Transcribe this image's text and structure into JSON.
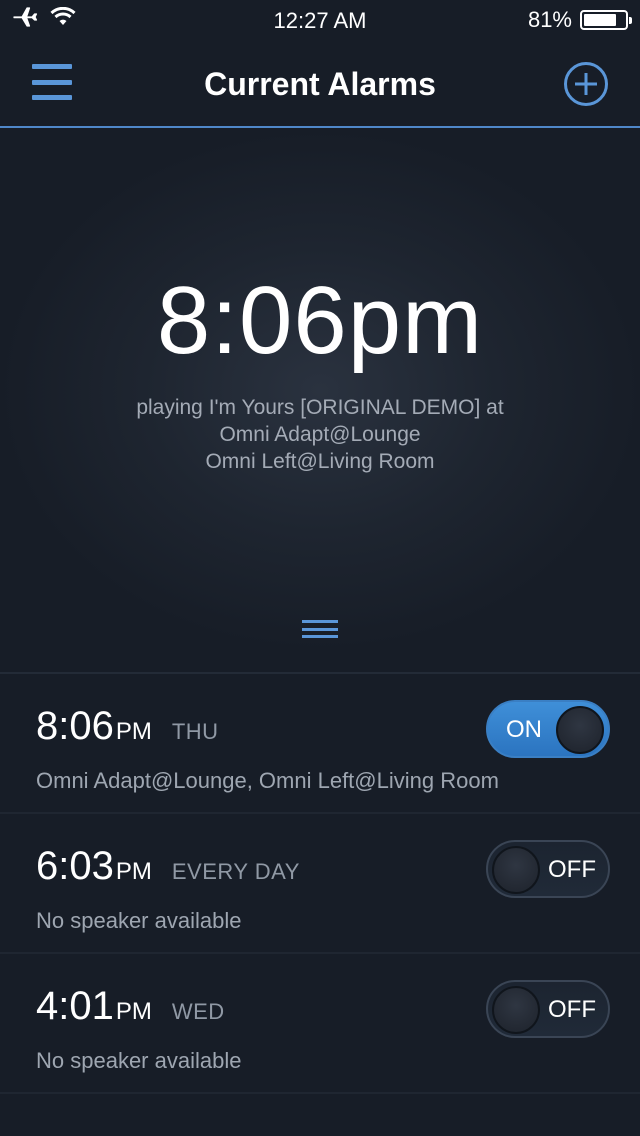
{
  "status_bar": {
    "time": "12:27 AM",
    "battery_text": "81%",
    "battery_level": 0.81,
    "icons": [
      "airplane-icon",
      "wifi-icon",
      "battery-icon"
    ]
  },
  "nav": {
    "title": "Current Alarms",
    "menu_icon": "hamburger-menu-icon",
    "add_icon": "plus-circle-icon"
  },
  "hero": {
    "time": "8:06pm",
    "line1": "playing I'm Yours [ORIGINAL DEMO] at",
    "line2": "Omni Adapt@Lounge",
    "line3": "Omni Left@Living Room"
  },
  "alarms": [
    {
      "hm": "8:06",
      "ampm": "PM",
      "days": "THU",
      "speakers": "Omni Adapt@Lounge, Omni Left@Living Room",
      "toggle_label": "ON",
      "enabled": true
    },
    {
      "hm": "6:03",
      "ampm": "PM",
      "days": "EVERY DAY",
      "speakers": "No speaker available",
      "toggle_label": "OFF",
      "enabled": false
    },
    {
      "hm": "4:01",
      "ampm": "PM",
      "days": "WED",
      "speakers": "No speaker available",
      "toggle_label": "OFF",
      "enabled": false
    }
  ],
  "colors": {
    "background": "#171d27",
    "accent": "#5a96d8",
    "toggle_on": "#3a86d0",
    "secondary_text": "#9ea6b1"
  }
}
